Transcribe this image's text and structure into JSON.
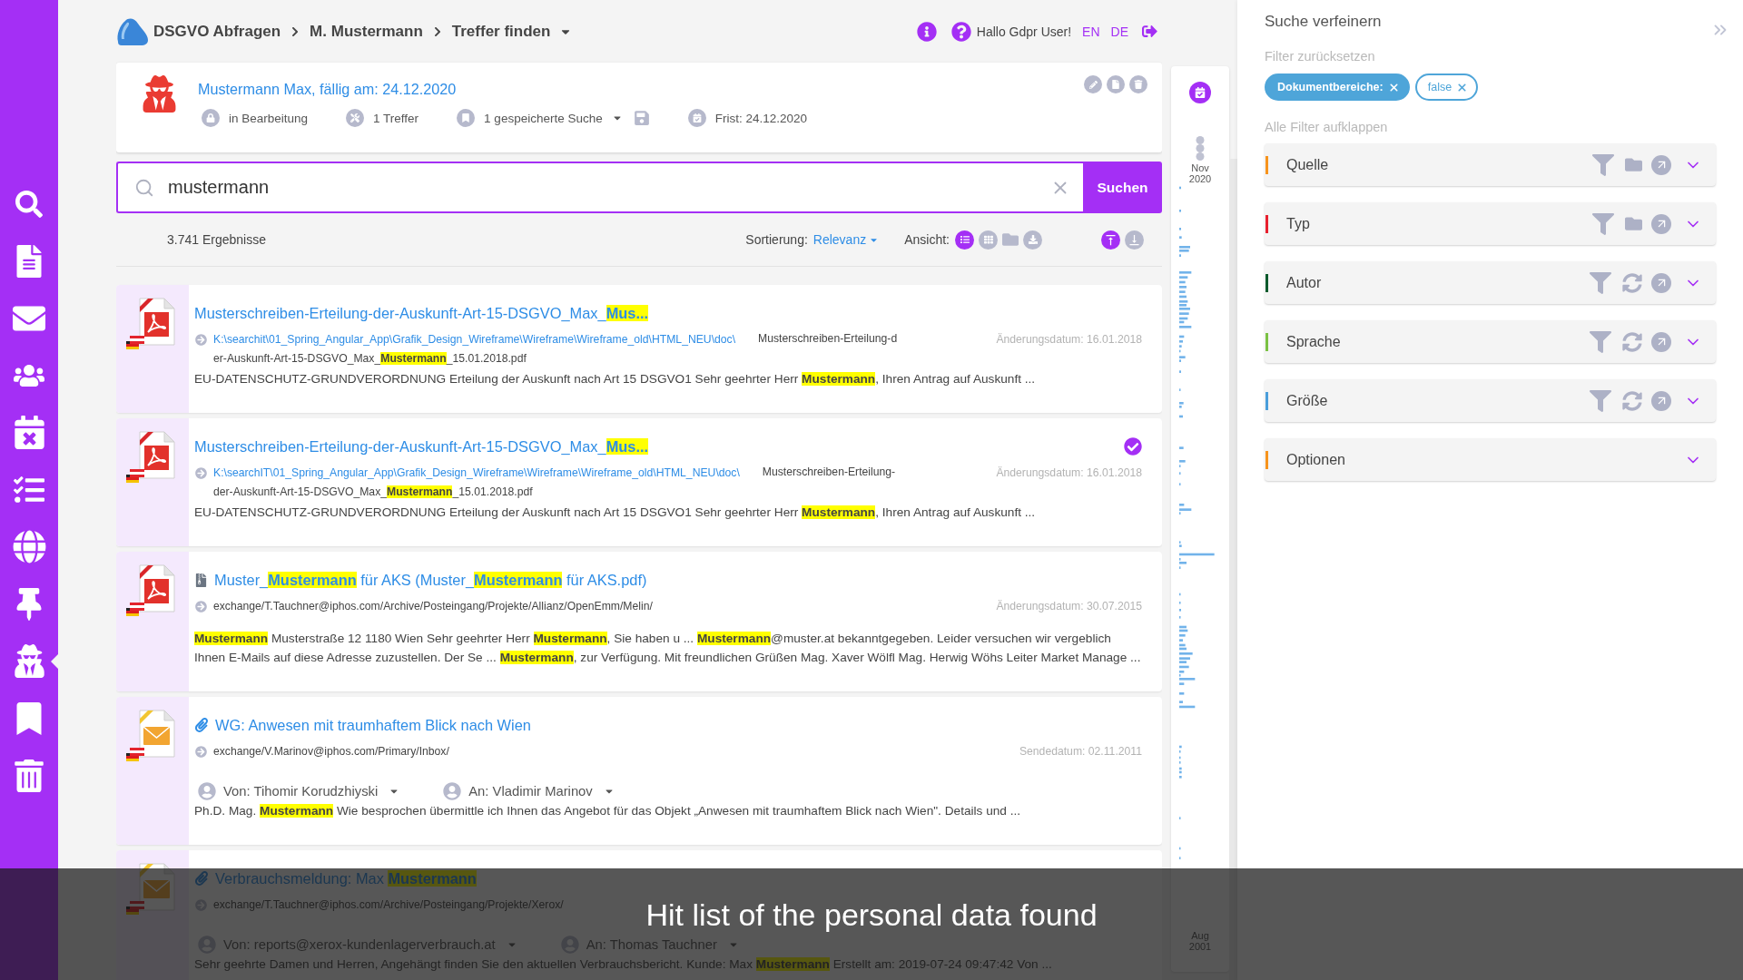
{
  "sidebar": {
    "items": [
      {
        "kind": "search",
        "selected": false
      },
      {
        "kind": "document",
        "selected": false
      },
      {
        "kind": "mail",
        "selected": false
      },
      {
        "kind": "people",
        "selected": false
      },
      {
        "kind": "calendar",
        "selected": false
      },
      {
        "kind": "tasks",
        "selected": false
      },
      {
        "kind": "globe",
        "selected": false
      },
      {
        "kind": "pin",
        "selected": false
      },
      {
        "kind": "agent",
        "selected": true
      },
      {
        "kind": "bookmark",
        "selected": false
      },
      {
        "kind": "trash",
        "selected": false
      }
    ]
  },
  "breadcrumb": [
    "DSGVO Abfragen",
    "M. Mustermann",
    "Treffer finden"
  ],
  "user_bar": {
    "greeting": "Hallo Gdpr User!",
    "languages": [
      "EN",
      "DE"
    ]
  },
  "case_card": {
    "title": "Mustermann Max, fällig am: 24.12.2020",
    "status": "in Bearbeitung",
    "hits": "1 Treffer",
    "saved_searches": "1 gespeicherte Suche",
    "deadline": "Frist: 24.12.2020"
  },
  "search": {
    "value": "mustermann",
    "button": "Suchen"
  },
  "results_bar": {
    "count": "3.741 Ergebnisse",
    "sort_label": "Sortierung:",
    "sort_value": "Relevanz",
    "view_label": "Ansicht:",
    "views": [
      {
        "kind": "list",
        "selected": true
      },
      {
        "kind": "grid",
        "selected": false
      },
      {
        "kind": "folder",
        "selected": false
      },
      {
        "kind": "export",
        "selected": false
      }
    ],
    "layouts": [
      {
        "kind": "expanded",
        "selected": true
      },
      {
        "kind": "compact",
        "selected": false
      }
    ]
  },
  "results": [
    {
      "kind": "file",
      "checked": false,
      "title": "Musterschreiben-Erteilung-der-Auskunft-Art-15-DSGVO_Max_**Mus...**",
      "path": "K:\\searchit\\01_Spring_Angular_App\\Grafik_Design_Wireframe\\Wireframe\\Wireframe_old\\HTML_NEU\\doc\\",
      "file_name_lines": [
        "Musterschreiben-Erteilung-d",
        "er-Auskunft-Art-15-DSGVO_Max_**Mustermann**_15.01.2018.pdf"
      ],
      "date": "Änderungsdatum: 16.01.2018",
      "snippet": "EU-DATENSCHUTZ-GRUNDVERORDNUNG Erteilung der Auskunft nach Art 15 DSGVO1 Sehr geehrter Herr **Mustermann**, Ihren Antrag auf Auskunft ..."
    },
    {
      "kind": "file",
      "checked": true,
      "title": "Musterschreiben-Erteilung-der-Auskunft-Art-15-DSGVO_Max_**Mus...**",
      "path": "K:\\searchIT\\01_Spring_Angular_App\\Grafik_Design_Wireframe\\Wireframe\\Wireframe_old\\HTML_NEU\\doc\\",
      "file_name_lines": [
        "Musterschreiben-Erteilung-",
        "der-Auskunft-Art-15-DSGVO_Max_**Mustermann**_15.01.2018.pdf"
      ],
      "date": "Änderungsdatum: 16.01.2018",
      "snippet": "EU-DATENSCHUTZ-GRUNDVERORDNUNG Erteilung der Auskunft nach Art 15 DSGVO1 Sehr geehrter Herr **Mustermann**, Ihren Antrag auf Auskunft ..."
    },
    {
      "kind": "archive",
      "checked": false,
      "title": "Muster_**Mustermann** für AKS (Muster_**Mustermann** für AKS.pdf)",
      "path": "exchange/T.Tauchner@iphos.com/Archive/Posteingang/Projekte/Allianz/OpenEmm/Melin/",
      "date": "Änderungsdatum: 30.07.2015",
      "snippet": "**Mustermann** Musterstraße 12 1180 Wien Sehr geehrter Herr **Mustermann**, Sie haben u ... **Mustermann**@muster.at bekanntgegeben. Leider versuchen wir vergeblich Ihnen E-Mails auf diese Adresse zuzustellen. Der Se ... **Mustermann**, zur Verfügung. Mit freundlichen Grüßen Mag. Xaver Wölfl Mag. Herwig Wöhs Leiter Market Manage ..."
    },
    {
      "kind": "mail",
      "checked": false,
      "title": "WG: Anwesen mit traumhaftem Blick nach Wien",
      "path": "exchange/V.Marinov@iphos.com/Primary/Inbox/",
      "date": "Sendedatum: 02.11.2011",
      "from": "Von: Tihomir Korudzhiyski",
      "to": "An: Vladimir Marinov",
      "snippet": "Ph.D. Mag. **Mustermann** Wie besprochen übermittle ich Ihnen das Angebot für das Objekt „Anwesen mit traumhaftem Blick nach Wien\". Details und ..."
    },
    {
      "kind": "mail",
      "checked": false,
      "title": "Verbrauchsmeldung: Max **Mustermann**",
      "path": "exchange/T.Tauchner@iphos.com/Archive/Posteingang/Projekte/Xerox/",
      "from": "Von: reports@xerox-kundenlagerverbrauch.at",
      "to": "An: Thomas Tauchner",
      "snippet": "Sehr geehrte Damen und Herren, Angehängt finden Sie den aktuellen Verbrauchsbericht. Kunde: Max **Mustermann** Erstellt am: 2019-07-24 09:47:42 Von ..."
    }
  ],
  "timeline": {
    "start": "Nov 2020",
    "end": "Aug 2001"
  },
  "refine_panel": {
    "title": "Suche verfeinern",
    "reset": "Filter zurücksetzen",
    "chips": [
      {
        "kind": "field",
        "label": "Dokumentbereiche:"
      },
      {
        "kind": "value",
        "label": "false"
      }
    ],
    "expand_all": "Alle Filter aufklappen",
    "filters": [
      {
        "kind": "folder",
        "label": "Quelle",
        "color": "#f7941d",
        "expanded": false
      },
      {
        "kind": "folder",
        "label": "Typ",
        "color": "#e8202f",
        "expanded": false
      },
      {
        "kind": "sync",
        "label": "Autor",
        "color": "#0b5a2c",
        "expanded": false
      },
      {
        "kind": "sync",
        "label": "Sprache",
        "color": "#7ac143",
        "expanded": false
      },
      {
        "kind": "sync",
        "label": "Größe",
        "color": "#4a9edb",
        "expanded": false
      },
      {
        "kind": "plain",
        "label": "Optionen",
        "color": "#f7941d",
        "expanded": false
      }
    ]
  },
  "caption": "Hit list of the personal data found"
}
